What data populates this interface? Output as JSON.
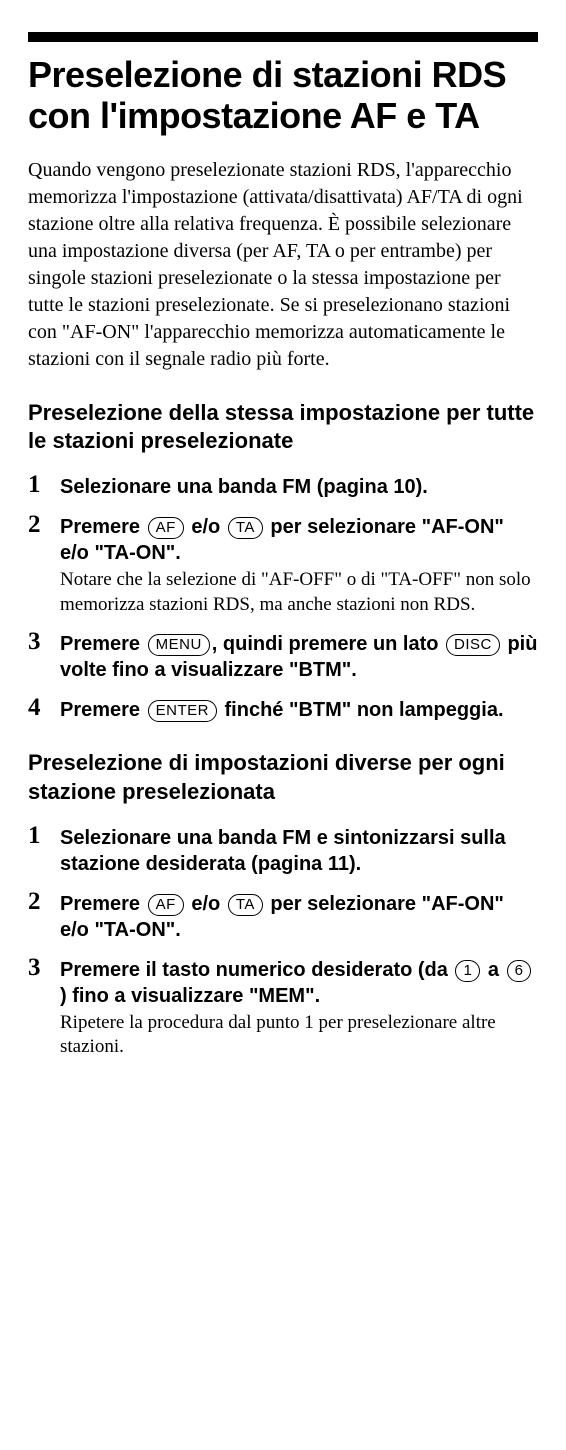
{
  "title": "Preselezione di stazioni RDS con l'impostazione AF e TA",
  "intro": "Quando vengono preselezionate stazioni RDS, l'apparecchio memorizza l'impostazione (attivata/disattivata) AF/TA di ogni stazione oltre alla relativa frequenza. È possibile selezionare una impostazione diversa (per AF, TA o per entrambe) per singole stazioni preselezionate o la stessa impostazione per tutte le stazioni preselezionate. Se si preselezionano stazioni con \"AF-ON\" l'apparecchio memorizza automaticamente le stazioni con il segnale radio più forte.",
  "section_a": {
    "heading": "Preselezione della stessa impostazione per tutte le stazioni preselezionate",
    "steps": {
      "s1": {
        "main": "Selezionare una banda FM (pagina 10)."
      },
      "s2": {
        "p1": "Premere ",
        "k1": "AF",
        "p2": " e/o ",
        "k2": "TA",
        "p3": " per selezionare \"AF-ON\" e/o \"TA-ON\".",
        "note": "Notare che la selezione di \"AF-OFF\" o di \"TA-OFF\" non solo memorizza stazioni RDS, ma anche stazioni non RDS."
      },
      "s3": {
        "p1": "Premere ",
        "k1": "MENU",
        "p2": ", quindi premere un lato ",
        "k2": "DISC",
        "p3": " più volte fino a visualizzare \"BTM\"."
      },
      "s4": {
        "p1": "Premere ",
        "k1": "ENTER",
        "p2": " finché \"BTM\" non lampeggia."
      }
    }
  },
  "section_b": {
    "heading": "Preselezione di impostazioni diverse per ogni stazione preselezionata",
    "steps": {
      "s1": {
        "main": "Selezionare una banda FM e sintonizzarsi sulla stazione desiderata (pagina 11)."
      },
      "s2": {
        "p1": "Premere ",
        "k1": "AF",
        "p2": " e/o ",
        "k2": "TA",
        "p3": " per selezionare \"AF-ON\" e/o \"TA-ON\"."
      },
      "s3": {
        "p1": "Premere il tasto numerico desiderato (da ",
        "k1": "1",
        "p2": " a ",
        "k2": "6",
        "p3": " ) fino a visualizzare \"MEM\".",
        "note": "Ripetere la procedura dal punto 1 per preselezionare altre stazioni."
      }
    }
  }
}
